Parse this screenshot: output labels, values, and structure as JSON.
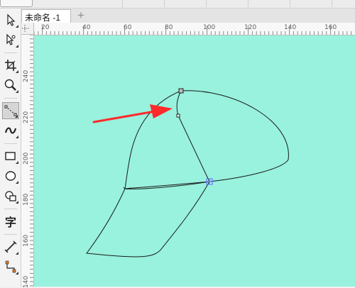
{
  "document": {
    "tab_label": "未命名 -1",
    "new_tab_symbol": "+"
  },
  "rulers": {
    "horizontal_labels": [
      "20",
      "40",
      "60",
      "80",
      "100",
      "120",
      "140",
      "160"
    ],
    "vertical_labels": [
      "240",
      "220",
      "200",
      "180",
      "160",
      "140"
    ]
  },
  "toolbox": {
    "tools": [
      {
        "name": "pick-tool-icon",
        "glyph": ""
      },
      {
        "name": "shape-tool-icon",
        "glyph": ""
      },
      {
        "name": "crop-tool-icon",
        "glyph": ""
      },
      {
        "name": "zoom-tool-icon",
        "glyph": ""
      },
      {
        "name": "freehand-tool-icon",
        "glyph": ""
      },
      {
        "name": "artistic-media-icon",
        "glyph": ""
      },
      {
        "name": "rectangle-tool-icon",
        "glyph": ""
      },
      {
        "name": "ellipse-tool-icon",
        "glyph": ""
      },
      {
        "name": "polygon-tool-icon",
        "glyph": ""
      },
      {
        "name": "text-tool-icon",
        "glyph": "字"
      },
      {
        "name": "dimension-tool-icon",
        "glyph": ""
      },
      {
        "name": "connector-tool-icon",
        "glyph": ""
      }
    ]
  },
  "colors": {
    "canvas": "#98f2dd",
    "arrow": "#ff2a2a",
    "curve": "#1a1a1a",
    "node_selected": "#6b6bff"
  }
}
